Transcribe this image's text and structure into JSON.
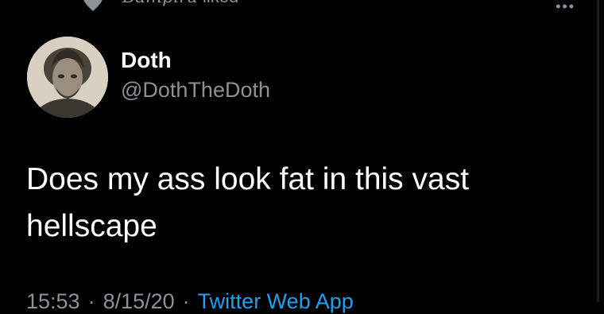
{
  "social_context": {
    "liked_by": "Bampira",
    "suffix": "liked",
    "icon": "heart-icon"
  },
  "more_icon": "•••",
  "tweet": {
    "display_name": "Doth",
    "handle": "@DothTheDoth",
    "text": "Does my ass look fat in this vast\nhellscape",
    "time": "15:53",
    "date": "8/15/20",
    "source": "Twitter Web App"
  },
  "colors": {
    "background": "#000000",
    "text": "#ffffff",
    "secondary": "#8b9197",
    "link": "#1da1f2"
  }
}
